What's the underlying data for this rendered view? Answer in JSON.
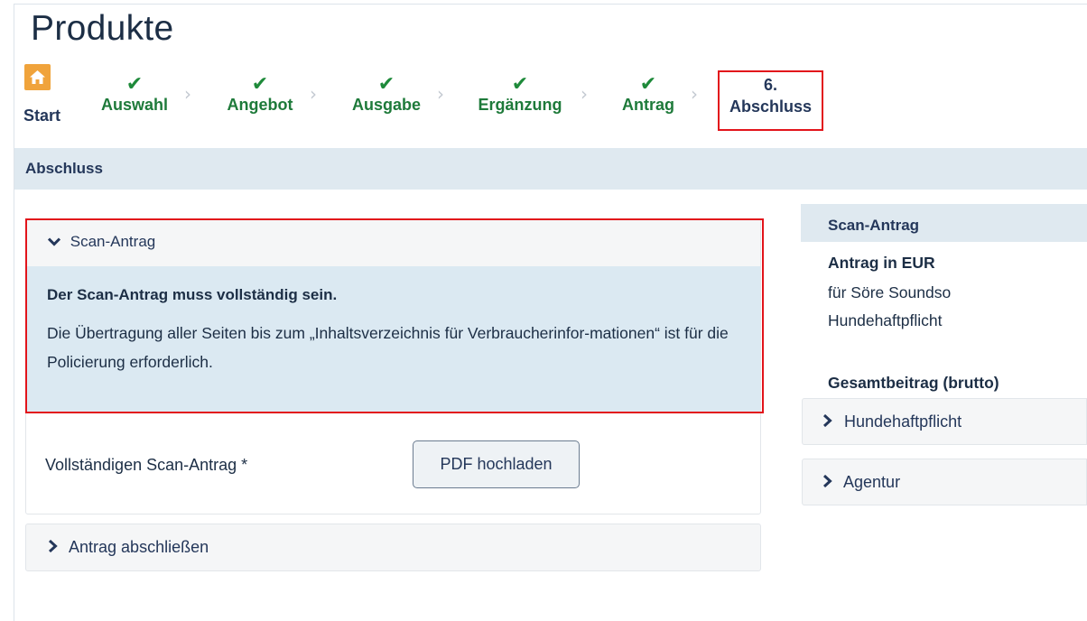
{
  "page": {
    "title": "Produkte"
  },
  "stepper": {
    "start": "Start",
    "steps": [
      {
        "label": "Auswahl",
        "state": "done"
      },
      {
        "label": "Angebot",
        "state": "done"
      },
      {
        "label": "Ausgabe",
        "state": "done"
      },
      {
        "label": "Ergänzung",
        "state": "done"
      },
      {
        "label": "Antrag",
        "state": "done"
      }
    ],
    "active": {
      "number": "6.",
      "label": "Abschluss"
    },
    "check_glyph": "✔",
    "chevron_glyph": "›"
  },
  "section": {
    "title": "Abschluss"
  },
  "scan_card": {
    "header": "Scan-Antrag",
    "info_title": "Der Scan-Antrag muss vollständig sein.",
    "info_text": "Die Übertragung aller Seiten bis zum „Inhaltsverzeichnis für Verbraucherinfor-mationen“ ist für die Policierung erforderlich.",
    "upload_label": "Vollständigen Scan-Antrag *",
    "upload_button": "PDF hochladen"
  },
  "accordion_finish": {
    "label": "Antrag abschließen"
  },
  "sidebar": {
    "header": "Scan-Antrag",
    "currency_title": "Antrag in EUR",
    "for_line": "für Söre Soundso",
    "product": "Hundehaftpflicht",
    "total_label": "Gesamtbeitrag (brutto)",
    "accordions": [
      {
        "label": "Hundehaftpflicht"
      },
      {
        "label": "Agentur"
      }
    ]
  },
  "icons": {
    "home": "home-icon",
    "check": "check-icon",
    "chevron": "chevron-right-icon",
    "caret_down": "caret-down-icon"
  },
  "colors": {
    "accent_orange": "#f0a33b",
    "check_green": "#1e8a3a",
    "highlight_red": "#e2141b",
    "info_blue": "#dbe9f2",
    "bar_blue": "#dfe9f0",
    "text_navy": "#1c2e45"
  }
}
